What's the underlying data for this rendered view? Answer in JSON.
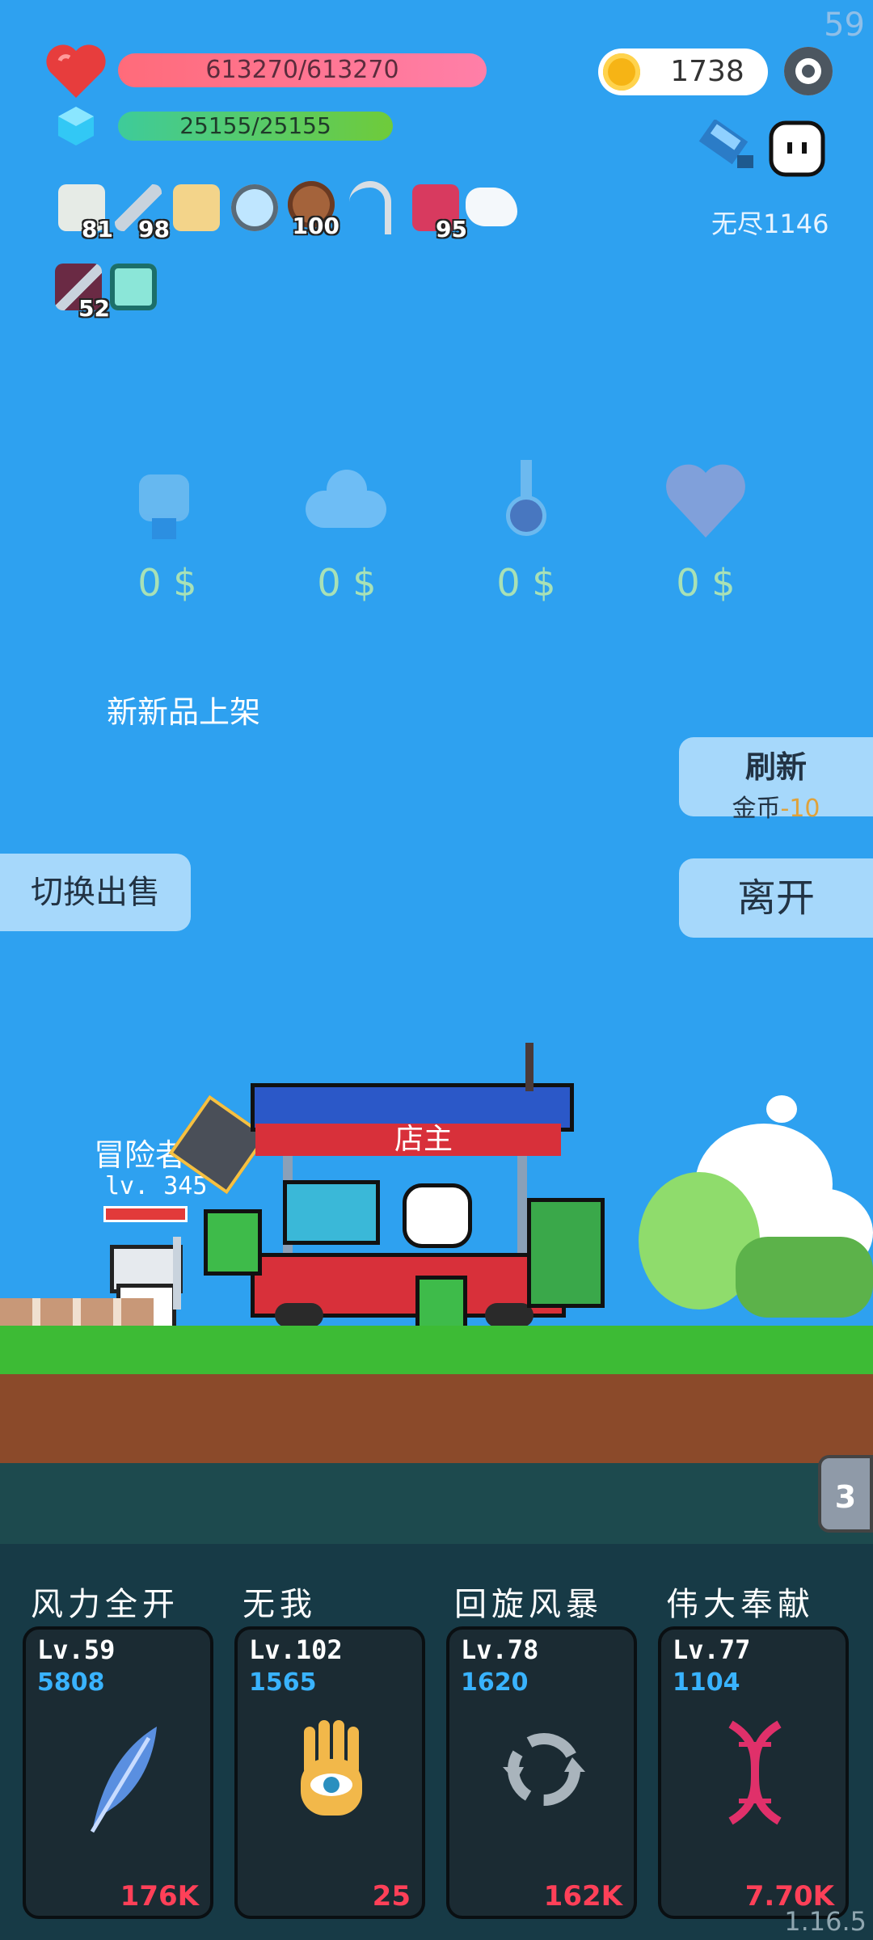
{
  "status": {
    "fps": "59",
    "hp_text": "613270/613270",
    "hp_fraction": 1.0,
    "mp_text": "25155/25155",
    "mp_fraction": 1.0,
    "coins": "1738",
    "endless_label": "无尽1146"
  },
  "inventory": [
    {
      "icon": "flower-icon",
      "count": "81"
    },
    {
      "icon": "sword-icon",
      "count": "98"
    },
    {
      "icon": "map-icon",
      "count": ""
    },
    {
      "icon": "magnifier-icon",
      "count": ""
    },
    {
      "icon": "shield-icon",
      "count": "100"
    },
    {
      "icon": "hook-icon",
      "count": ""
    },
    {
      "icon": "jam-jar-icon",
      "count": "95"
    },
    {
      "icon": "wing-icon",
      "count": ""
    },
    {
      "icon": "scroll-icon",
      "count": "52"
    },
    {
      "icon": "light-card-icon",
      "count": ""
    }
  ],
  "shop": {
    "items": [
      {
        "icon": "fist-icon",
        "price": "0 $"
      },
      {
        "icon": "cloud-icon",
        "price": "0 $"
      },
      {
        "icon": "potion-icon",
        "price": "0 $"
      },
      {
        "icon": "heart-icon",
        "price": "0 $"
      }
    ],
    "new_items_label": "新新品上架",
    "refresh_label": "刷新",
    "refresh_cost_prefix": "金币",
    "refresh_cost": "-10",
    "switch_sell_label": "切换出售",
    "leave_label": "离开"
  },
  "scene": {
    "adventurer_label": "冒险者",
    "adventurer_level": "lv. 345",
    "shopkeeper_label": "店主",
    "side_badge": "3"
  },
  "skills": [
    {
      "name": "风力全开",
      "level": "Lv.59",
      "value": "5808",
      "cost": "176K",
      "icon": "feather-icon"
    },
    {
      "name": "无我",
      "level": "Lv.102",
      "value": "1565",
      "cost": "25",
      "icon": "eye-hand-icon"
    },
    {
      "name": "回旋风暴",
      "level": "Lv.78",
      "value": "1620",
      "cost": "162K",
      "icon": "cycle-icon"
    },
    {
      "name": "伟大奉献",
      "level": "Lv.77",
      "value": "1104",
      "cost": "7.70K",
      "icon": "dna-icon"
    }
  ],
  "version": "1.16.5",
  "colors": {
    "sky": "#2ea1f0",
    "hp_bar": "#ff6b7a",
    "mp_bar": "#59c24a",
    "coin": "#f6b415",
    "skill_value": "#39b3ff",
    "skill_cost": "#ff4058"
  }
}
